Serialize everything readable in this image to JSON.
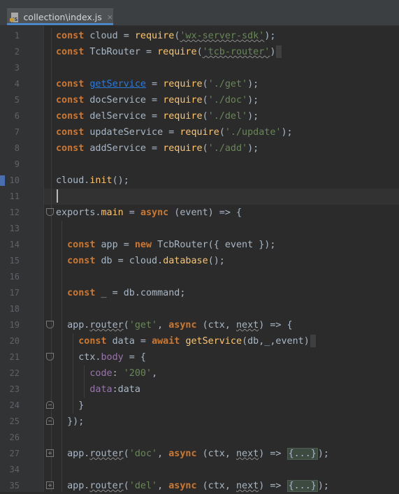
{
  "tab": {
    "label": "collection\\index.js",
    "icon": "js-file-icon",
    "close": "×"
  },
  "lines": [
    {
      "n": "1",
      "segs": [
        [
          "kw",
          "const"
        ],
        [
          "p",
          " cloud = "
        ],
        [
          "fn",
          "require"
        ],
        [
          "p",
          "("
        ],
        [
          "str squig",
          "'wx-server-sdk'"
        ],
        [
          "p",
          ");"
        ]
      ]
    },
    {
      "n": "2",
      "segs": [
        [
          "kw",
          "const"
        ],
        [
          "p",
          " TcbRouter = "
        ],
        [
          "fn",
          "require"
        ],
        [
          "p",
          "("
        ],
        [
          "str squig",
          "'tcb-router'"
        ],
        [
          "p",
          ")"
        ],
        [
          "sel",
          ""
        ]
      ]
    },
    {
      "n": "3",
      "segs": []
    },
    {
      "n": "4",
      "segs": [
        [
          "kw",
          "const"
        ],
        [
          "p",
          " "
        ],
        [
          "link",
          "getService"
        ],
        [
          "p",
          " = "
        ],
        [
          "fn",
          "require"
        ],
        [
          "p",
          "("
        ],
        [
          "str",
          "'./get'"
        ],
        [
          "p",
          ");"
        ]
      ]
    },
    {
      "n": "5",
      "segs": [
        [
          "kw",
          "const"
        ],
        [
          "p",
          " docService = "
        ],
        [
          "fn",
          "require"
        ],
        [
          "p",
          "("
        ],
        [
          "str",
          "'./doc'"
        ],
        [
          "p",
          ");"
        ]
      ]
    },
    {
      "n": "6",
      "segs": [
        [
          "kw",
          "const"
        ],
        [
          "p",
          " delService = "
        ],
        [
          "fn",
          "require"
        ],
        [
          "p",
          "("
        ],
        [
          "str",
          "'./del'"
        ],
        [
          "p",
          ");"
        ]
      ]
    },
    {
      "n": "7",
      "segs": [
        [
          "kw",
          "const"
        ],
        [
          "p",
          " updateService = "
        ],
        [
          "fn",
          "require"
        ],
        [
          "p",
          "("
        ],
        [
          "str",
          "'./update'"
        ],
        [
          "p",
          ");"
        ]
      ]
    },
    {
      "n": "8",
      "segs": [
        [
          "kw",
          "const"
        ],
        [
          "p",
          " addService = "
        ],
        [
          "fn",
          "require"
        ],
        [
          "p",
          "("
        ],
        [
          "str",
          "'./add'"
        ],
        [
          "p",
          ");"
        ]
      ]
    },
    {
      "n": "9",
      "segs": []
    },
    {
      "n": "10",
      "segs": [
        [
          "p",
          "cloud."
        ],
        [
          "meth",
          "init"
        ],
        [
          "p",
          "();"
        ]
      ]
    },
    {
      "n": "11",
      "segs": []
    },
    {
      "n": "12",
      "segs": [
        [
          "p",
          "exports."
        ],
        [
          "fn",
          "main"
        ],
        [
          "p",
          " = "
        ],
        [
          "kw",
          "async"
        ],
        [
          "p",
          " (event) => {"
        ]
      ]
    },
    {
      "n": "13",
      "segs": []
    },
    {
      "n": "14",
      "segs": [
        [
          "p",
          "  "
        ],
        [
          "kw",
          "const"
        ],
        [
          "p",
          " app = "
        ],
        [
          "kw",
          "new"
        ],
        [
          "p",
          " TcbRouter({ event });"
        ]
      ]
    },
    {
      "n": "15",
      "segs": [
        [
          "p",
          "  "
        ],
        [
          "kw",
          "const"
        ],
        [
          "p",
          " db = cloud."
        ],
        [
          "meth",
          "database"
        ],
        [
          "p",
          "();"
        ]
      ]
    },
    {
      "n": "16",
      "segs": []
    },
    {
      "n": "17",
      "segs": [
        [
          "p",
          "  "
        ],
        [
          "kw",
          "const"
        ],
        [
          "p",
          " _ = db.command;"
        ]
      ]
    },
    {
      "n": "18",
      "segs": []
    },
    {
      "n": "19",
      "segs": [
        [
          "p",
          "  app."
        ],
        [
          "squig",
          "router"
        ],
        [
          "p",
          "("
        ],
        [
          "str",
          "'get'"
        ],
        [
          "p",
          ", "
        ],
        [
          "kw",
          "async"
        ],
        [
          "p",
          " (ctx, "
        ],
        [
          "squig",
          "next"
        ],
        [
          "p",
          ") => {"
        ]
      ]
    },
    {
      "n": "20",
      "segs": [
        [
          "p",
          "    "
        ],
        [
          "kw",
          "const"
        ],
        [
          "p",
          " data = "
        ],
        [
          "kw",
          "await"
        ],
        [
          "p",
          " "
        ],
        [
          "fn",
          "getService"
        ],
        [
          "p",
          "(db,_,event)"
        ],
        [
          "sel",
          ""
        ]
      ]
    },
    {
      "n": "21",
      "segs": [
        [
          "p",
          "    ctx."
        ],
        [
          "prop",
          "body"
        ],
        [
          "p",
          " = {"
        ]
      ]
    },
    {
      "n": "22",
      "segs": [
        [
          "p",
          "      "
        ],
        [
          "prop",
          "code"
        ],
        [
          "p",
          ": "
        ],
        [
          "str",
          "'200'"
        ],
        [
          "p",
          ","
        ]
      ]
    },
    {
      "n": "23",
      "segs": [
        [
          "p",
          "      "
        ],
        [
          "prop",
          "data"
        ],
        [
          "p",
          ":data"
        ]
      ]
    },
    {
      "n": "24",
      "segs": [
        [
          "p",
          "    }"
        ]
      ]
    },
    {
      "n": "25",
      "segs": [
        [
          "p",
          "  });"
        ]
      ]
    },
    {
      "n": "26",
      "segs": []
    },
    {
      "n": "27",
      "segs": [
        [
          "p",
          "  app."
        ],
        [
          "squig",
          "router"
        ],
        [
          "p",
          "("
        ],
        [
          "str",
          "'doc'"
        ],
        [
          "p",
          ", "
        ],
        [
          "kw",
          "async"
        ],
        [
          "p",
          " (ctx, "
        ],
        [
          "squig",
          "next"
        ],
        [
          "p",
          ") => "
        ],
        [
          "fold",
          "{...}"
        ],
        [
          "p",
          ");"
        ]
      ]
    },
    {
      "n": "34",
      "segs": []
    },
    {
      "n": "35",
      "segs": [
        [
          "p",
          "  app."
        ],
        [
          "squig",
          "router"
        ],
        [
          "p",
          "("
        ],
        [
          "str",
          "'del'"
        ],
        [
          "p",
          ", "
        ],
        [
          "kw",
          "async"
        ],
        [
          "p",
          " (ctx, "
        ],
        [
          "squig",
          "next"
        ],
        [
          "p",
          ") => "
        ],
        [
          "fold",
          "{...}"
        ],
        [
          "p",
          ");"
        ]
      ]
    }
  ]
}
